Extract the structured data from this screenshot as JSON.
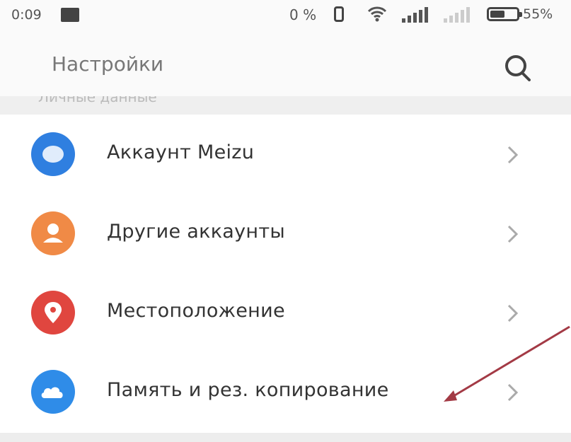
{
  "status_bar": {
    "time": "0:09",
    "data_speed": "0 %",
    "battery_percent": "55%",
    "battery_level": 0.55,
    "icons": [
      "image-icon",
      "vibrate-icon",
      "wifi-icon",
      "signal-icon",
      "signal-icon-sim2",
      "battery-icon"
    ]
  },
  "header": {
    "title": "Настройки",
    "search_icon": "search-icon"
  },
  "section": {
    "label": "Личные данные"
  },
  "items": [
    {
      "label": "Аккаунт Meizu",
      "icon": "meizu-account-icon",
      "color": "#2f7fe0"
    },
    {
      "label": "Другие аккаунты",
      "icon": "person-icon",
      "color": "#f08a46"
    },
    {
      "label": "Местоположение",
      "icon": "location-pin-icon",
      "color": "#e0463f"
    },
    {
      "label": "Память и рез. копирование",
      "icon": "cloud-icon",
      "color": "#2f8ce8"
    }
  ],
  "colors": {
    "annotation_arrow": "#a33a45",
    "chevron": "#aaaaaa"
  }
}
